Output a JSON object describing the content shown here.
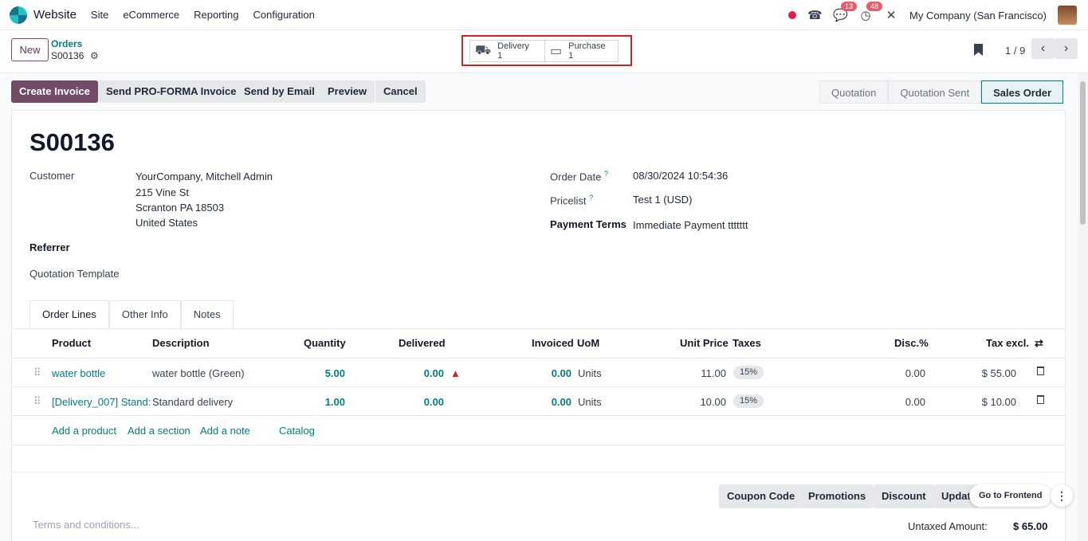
{
  "nav": {
    "app_name": "Website",
    "menu": [
      "Site",
      "eCommerce",
      "Reporting",
      "Configuration"
    ],
    "messages_badge": "13",
    "activities_badge": "48",
    "company": "My Company (San Francisco)"
  },
  "control_panel": {
    "new_label": "New",
    "breadcrumb_parent": "Orders",
    "record_name": "S00136",
    "smart_buttons": [
      {
        "label": "Delivery",
        "count": "1",
        "icon": "truck-icon"
      },
      {
        "label": "Purchase",
        "count": "1",
        "icon": "credit-card-icon"
      }
    ],
    "pager": "1 / 9"
  },
  "actions": {
    "create_invoice": "Create Invoice",
    "send_proforma": "Send PRO-FORMA Invoice",
    "send_email": "Send by Email",
    "preview": "Preview",
    "cancel": "Cancel"
  },
  "stages": [
    "Quotation",
    "Quotation Sent",
    "Sales Order"
  ],
  "form": {
    "title": "S00136",
    "customer_label": "Customer",
    "customer_name": "YourCompany, Mitchell Admin",
    "address_line1": "215 Vine St",
    "address_line2": "Scranton PA 18503",
    "address_line3": "United States",
    "referrer_label": "Referrer",
    "quotation_template_label": "Quotation Template",
    "order_date_label": "Order Date",
    "order_date": "08/30/2024 10:54:36",
    "pricelist_label": "Pricelist",
    "pricelist": "Test 1 (USD)",
    "payment_terms_label": "Payment Terms",
    "payment_terms": "Immediate Payment ttttttt",
    "help_mark": "?"
  },
  "tabs": [
    "Order Lines",
    "Other Info",
    "Notes"
  ],
  "table": {
    "headers": {
      "product": "Product",
      "description": "Description",
      "quantity": "Quantity",
      "delivered": "Delivered",
      "invoiced": "Invoiced",
      "uom": "UoM",
      "unit_price": "Unit Price",
      "taxes": "Taxes",
      "disc": "Disc.%",
      "tax_excl": "Tax excl."
    },
    "rows": [
      {
        "product": "water bottle",
        "description": "water bottle (Green)",
        "quantity": "5.00",
        "delivered": "0.00",
        "invoiced": "0.00",
        "uom": "Units",
        "unit_price": "11.00",
        "tax": "15%",
        "disc": "0.00",
        "subtotal": "$ 55.00"
      },
      {
        "product": "[Delivery_007] Stand:",
        "description": "Standard delivery",
        "quantity": "1.00",
        "delivered": "0.00",
        "invoiced": "0.00",
        "uom": "Units",
        "unit_price": "10.00",
        "tax": "15%",
        "disc": "0.00",
        "subtotal": "$ 10.00"
      }
    ],
    "add_product": "Add a product",
    "add_section": "Add a section",
    "add_note": "Add a note",
    "catalog": "Catalog"
  },
  "bottom": {
    "coupon": "Coupon Code",
    "promotions": "Promotions",
    "discount": "Discount",
    "update": "Updat",
    "terms_placeholder": "Terms and conditions...",
    "untaxed_label": "Untaxed Amount:",
    "untaxed_value": "$ 65.00"
  },
  "floating": {
    "go_frontend": "Go to Frontend"
  }
}
